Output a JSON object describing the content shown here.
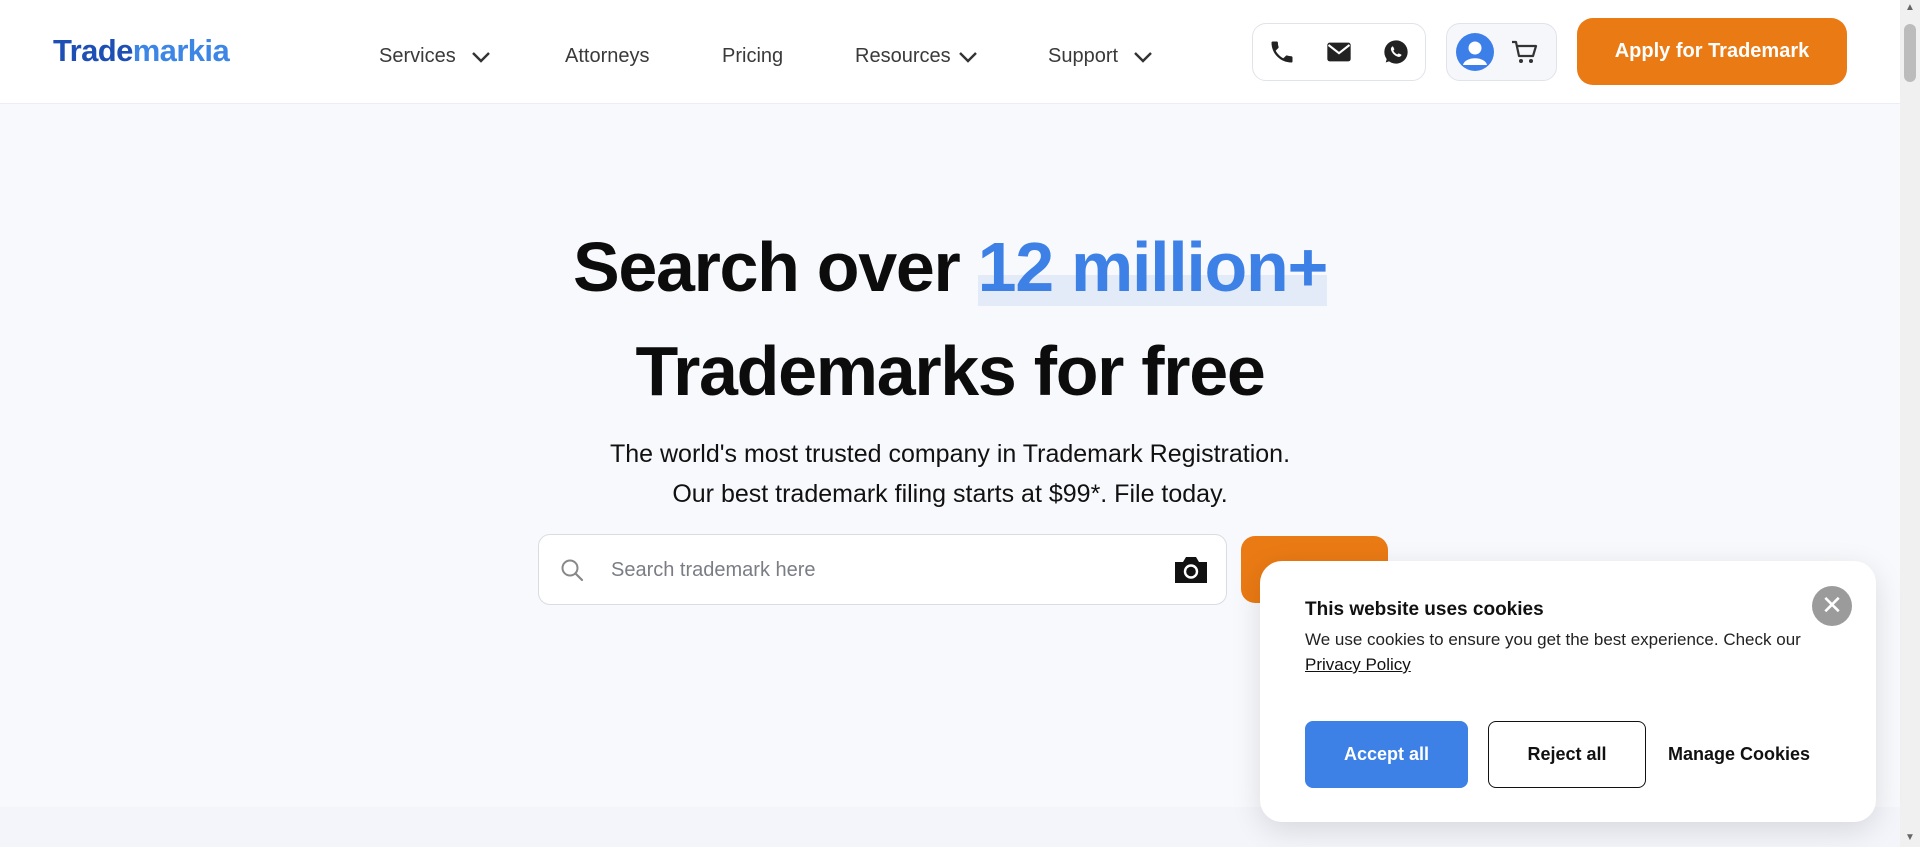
{
  "brand": {
    "logo_part1": "Trade",
    "logo_part2": "markia"
  },
  "nav": {
    "services": "Services",
    "attorneys": "Attorneys",
    "pricing": "Pricing",
    "resources": "Resources",
    "support": "Support"
  },
  "header": {
    "apply_label": "Apply for Trademark"
  },
  "hero": {
    "title_prefix": "Search over ",
    "title_highlight": "12 million+",
    "title_line2": "Trademarks for free",
    "subtitle1": "The world's most trusted company in Trademark Registration.",
    "subtitle2": "Our best trademark filing starts at $99*. File today."
  },
  "search": {
    "placeholder": "Search trademark here",
    "value": ""
  },
  "cookie": {
    "title": "This website uses cookies",
    "body": "We use cookies to ensure you get the best experience. Check our",
    "link": "Privacy Policy",
    "close_symbol": "✕",
    "accept": "Accept all",
    "reject": "Reject all",
    "manage": "Manage Cookies"
  },
  "colors": {
    "brand_blue": "#1d4fb5",
    "accent_blue": "#3d80e6",
    "orange": "#ea7a14"
  },
  "icons": [
    "phone-icon",
    "mail-icon",
    "whatsapp-icon",
    "user-icon",
    "cart-icon",
    "search-icon",
    "camera-icon",
    "close-icon",
    "chevron-down-icon"
  ]
}
